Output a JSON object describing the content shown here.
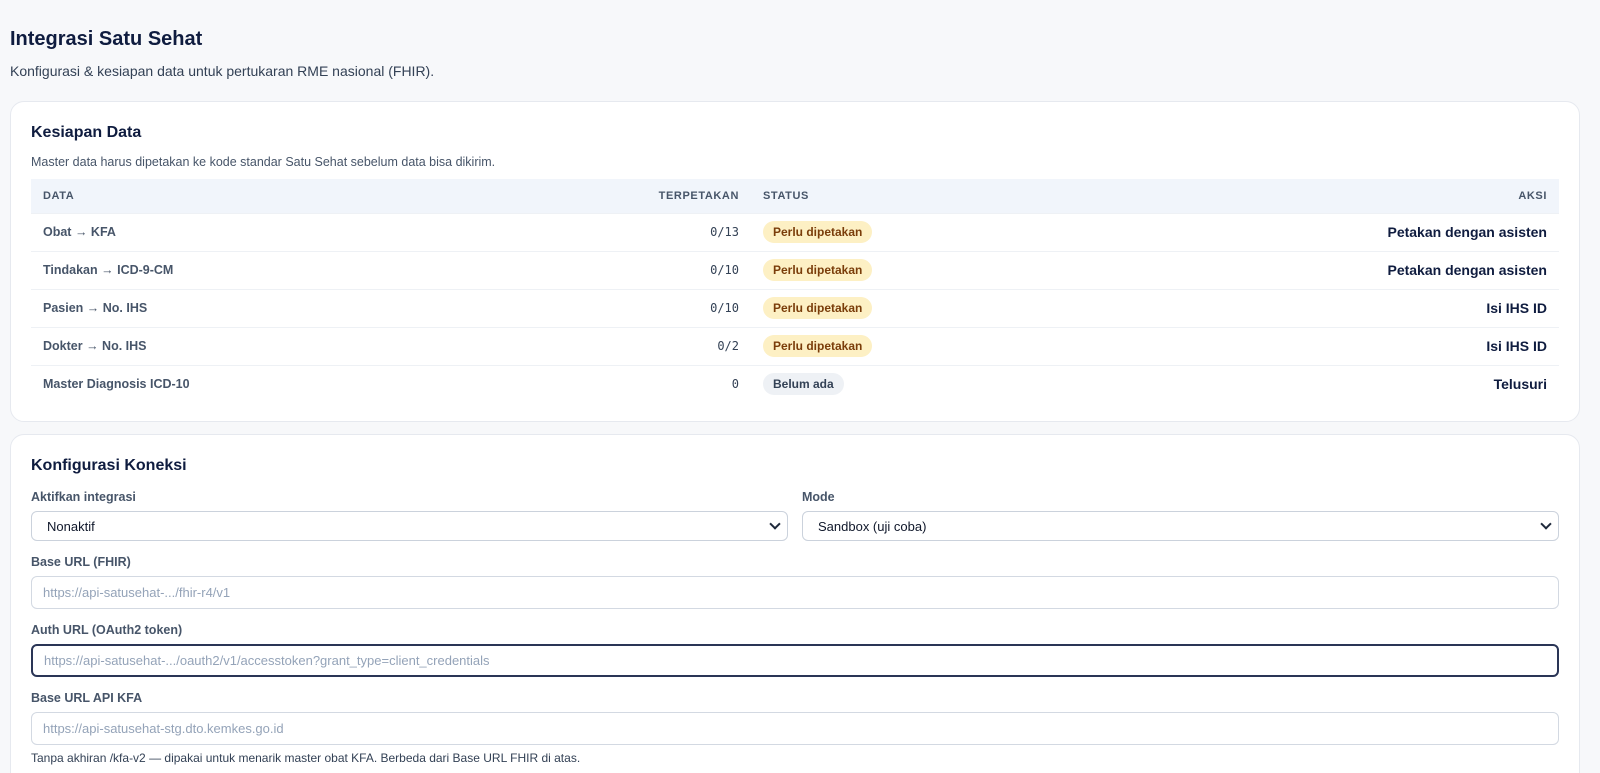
{
  "page": {
    "title": "Integrasi Satu Sehat",
    "subtitle": "Konfigurasi & kesiapan data untuk pertukaran RME nasional (FHIR)."
  },
  "readiness": {
    "title": "Kesiapan Data",
    "description": "Master data harus dipetakan ke kode standar Satu Sehat sebelum data bisa dikirim.",
    "columns": {
      "data": "DATA",
      "mapped": "TERPETAKAN",
      "status": "STATUS",
      "action": "AKSI"
    },
    "rows": [
      {
        "data": "Obat → KFA",
        "mapped": "0/13",
        "status": "Perlu dipetakan",
        "action": "Petakan dengan asisten"
      },
      {
        "data": "Tindakan → ICD-9-CM",
        "mapped": "0/10",
        "status": "Perlu dipetakan",
        "action": "Petakan dengan asisten"
      },
      {
        "data": "Pasien → No. IHS",
        "mapped": "0/10",
        "status": "Perlu dipetakan",
        "action": "Isi IHS ID"
      },
      {
        "data": "Dokter → No. IHS",
        "mapped": "0/2",
        "status": "Perlu dipetakan",
        "action": "Isi IHS ID"
      },
      {
        "data": "Master Diagnosis ICD-10",
        "mapped": "0",
        "status": "Belum ada",
        "action": "Telusuri"
      }
    ]
  },
  "connection": {
    "title": "Konfigurasi Koneksi",
    "enable": {
      "label": "Aktifkan integrasi",
      "value": "Nonaktif"
    },
    "mode": {
      "label": "Mode",
      "value": "Sandbox (uji coba)"
    },
    "base_url": {
      "label": "Base URL (FHIR)",
      "placeholder": "https://api-satusehat-.../fhir-r4/v1"
    },
    "auth_url": {
      "label": "Auth URL (OAuth2 token)",
      "placeholder": "https://api-satusehat-.../oauth2/v1/accesstoken?grant_type=client_credentials"
    },
    "kfa_url": {
      "label": "Base URL API KFA",
      "placeholder": "https://api-satusehat-stg.dto.kemkes.go.id",
      "hint": "Tanpa akhiran /kfa-v2 — dipakai untuk menarik master obat KFA. Berbeda dari Base URL FHIR di atas."
    }
  }
}
